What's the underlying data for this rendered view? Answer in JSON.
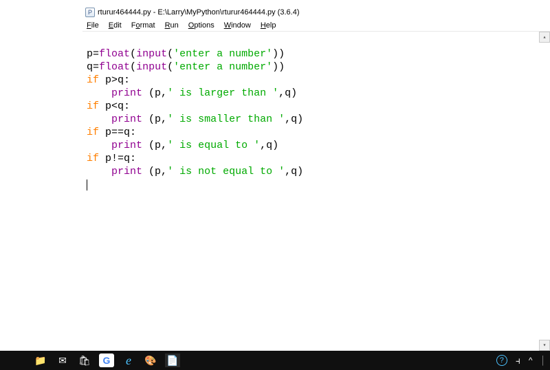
{
  "title": "rturur464444.py - E:\\Larry\\MyPython\\rturur464444.py (3.6.4)",
  "menu": {
    "file": "File",
    "edit": "Edit",
    "format": "Format",
    "run": "Run",
    "options": "Options",
    "window": "Window",
    "help": "Help"
  },
  "code": {
    "l1": {
      "v1": "p",
      "op": "=",
      "fn": "float",
      "p1": "(",
      "in": "input",
      "p2": "(",
      "s": "'enter a number'",
      "p3": "))"
    },
    "l2": {
      "v1": "q",
      "op": "=",
      "fn": "float",
      "p1": "(",
      "in": "input",
      "p2": "(",
      "s": "'enter a number'",
      "p3": "))"
    },
    "l3": {
      "kw": "if",
      "sp": " ",
      "expr": "p>q:"
    },
    "l4": {
      "indent": "    ",
      "fn": "print",
      "sp": " ",
      "p1": "(p,",
      "s": "' is larger than '",
      "p2": ",q)"
    },
    "l5": {
      "kw": "if",
      "sp": " ",
      "expr": "p<q:"
    },
    "l6": {
      "indent": "    ",
      "fn": "print",
      "sp": " ",
      "p1": "(p,",
      "s": "' is smaller than '",
      "p2": ",q)"
    },
    "l7": {
      "kw": "if",
      "sp": " ",
      "expr": "p==q:"
    },
    "l8": {
      "indent": "    ",
      "fn": "print",
      "sp": " ",
      "p1": "(p,",
      "s": "' is equal to '",
      "p2": ",q)"
    },
    "l9": {
      "kw": "if",
      "sp": " ",
      "expr": "p!=q:"
    },
    "l10": {
      "indent": "    ",
      "fn": "print",
      "sp": " ",
      "p1": "(p,",
      "s": "' is not equal to '",
      "p2": ",q)"
    }
  },
  "taskbar": {
    "folder": "📁",
    "mail": "✉",
    "store": "🛍",
    "chrome": "G",
    "edge": "e",
    "paint": "🎨",
    "idle": "📄"
  },
  "tray": {
    "help": "?",
    "people": "👥",
    "up": "^"
  }
}
